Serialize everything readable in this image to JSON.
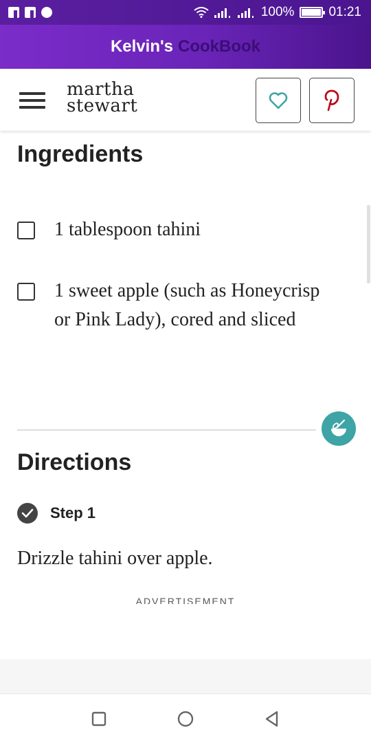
{
  "status_bar": {
    "battery": "100%",
    "time": "01:21"
  },
  "app_bar": {
    "title_part1": "Kelvin's",
    "title_part2": "CookBook"
  },
  "site_header": {
    "logo_line1": "martha",
    "logo_line2": "stewart"
  },
  "ingredients": {
    "title": "Ingredients",
    "items": [
      {
        "text": "1 tablespoon tahini",
        "checked": false
      },
      {
        "text": "1 sweet apple (such as Honeycrisp or Pink Lady), cored and sliced",
        "checked": false
      }
    ]
  },
  "directions": {
    "title": "Directions",
    "steps": [
      {
        "label": "Step 1",
        "text": "Drizzle tahini over apple.",
        "completed": true
      }
    ]
  },
  "advertisement_label": "ADVERTISEMENT",
  "colors": {
    "app_bar": "#6a24b8",
    "teal_accent": "#3ea4a5",
    "pinterest_red": "#bd081c"
  }
}
